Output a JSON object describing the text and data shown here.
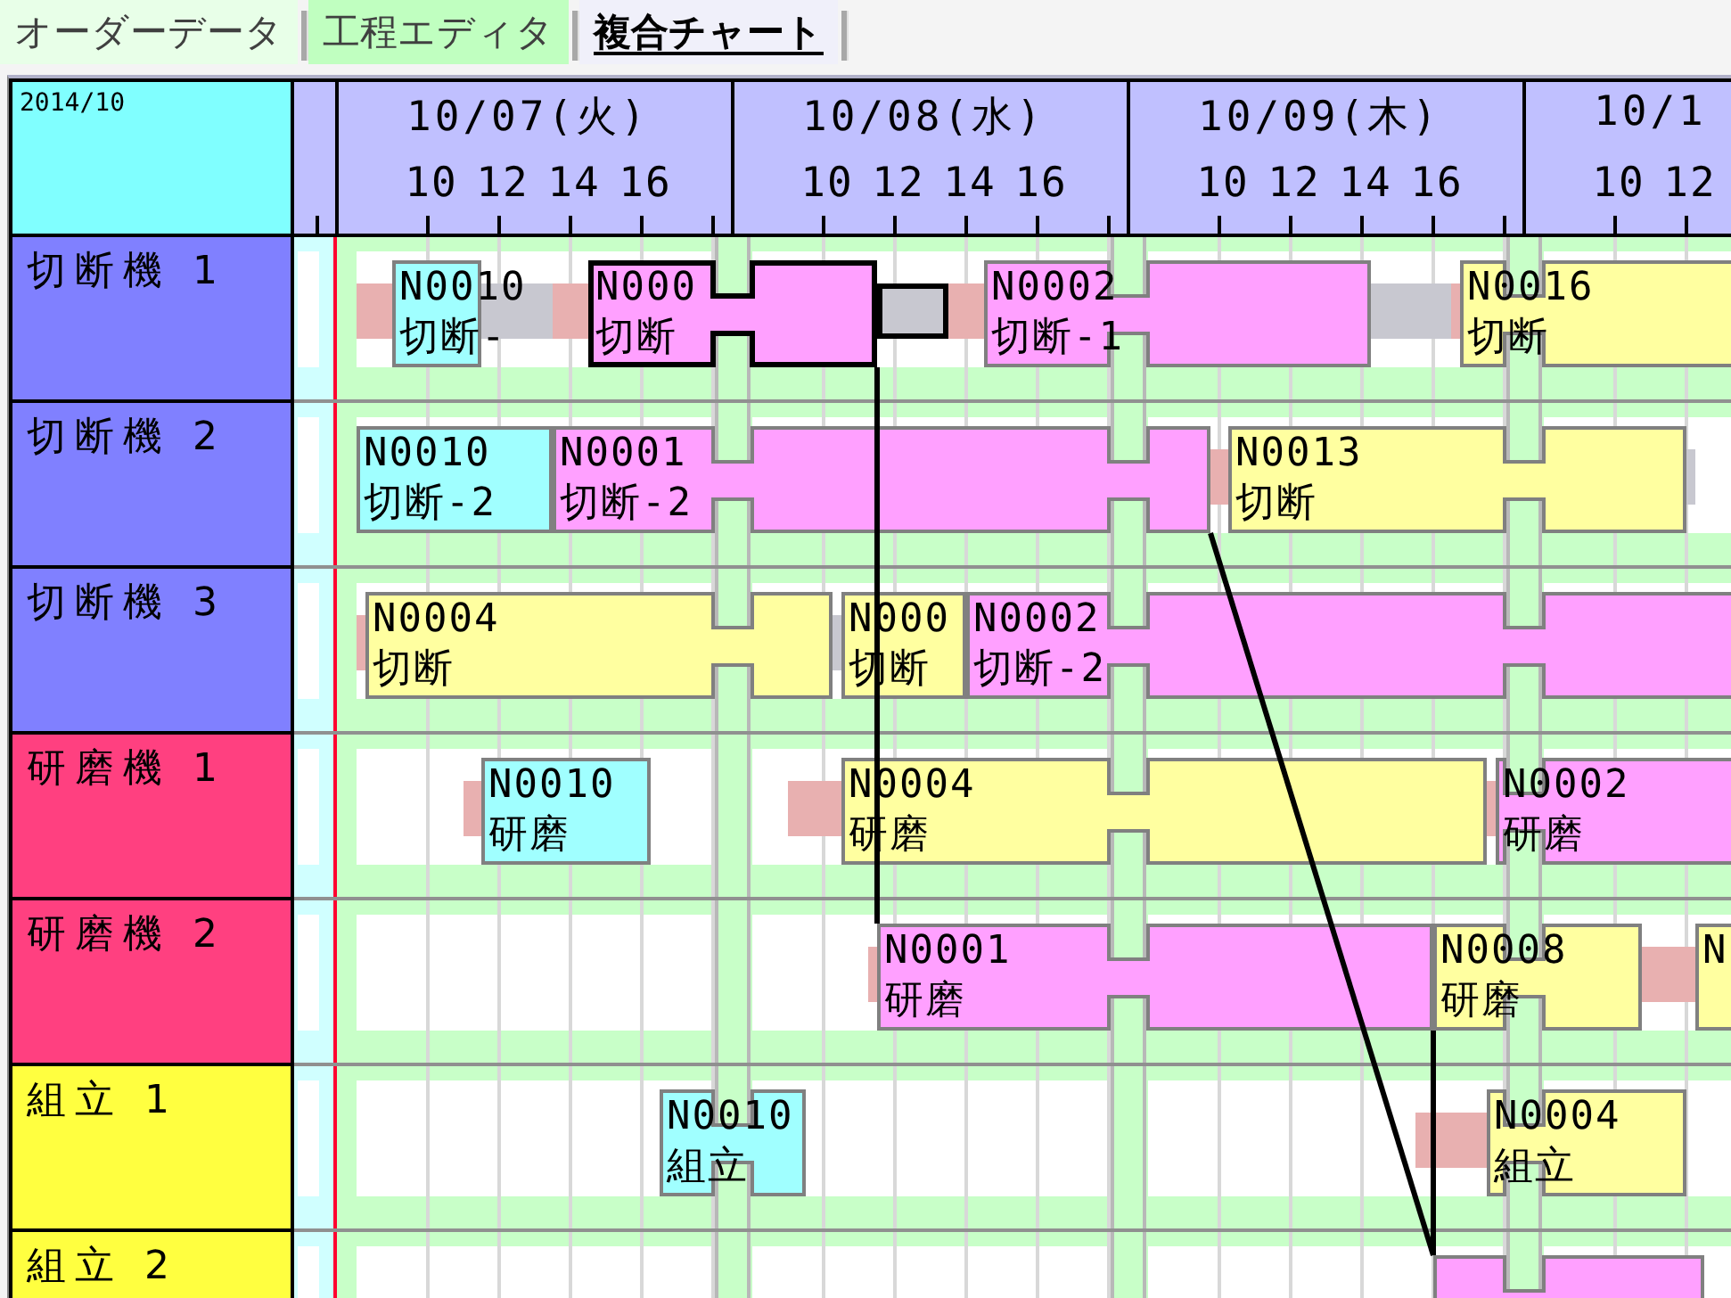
{
  "tabs": [
    {
      "label": "オーダーデータ",
      "selected": false,
      "color": "#e8ffe8"
    },
    {
      "label": "工程エディタ",
      "selected": false,
      "color": "#c0ffc0"
    },
    {
      "label": "複合チャート",
      "selected": true,
      "color": "#f0f0fa"
    }
  ],
  "chart": {
    "month": "2014/10",
    "days": [
      {
        "label": "10/07(火)",
        "hours": [
          "10",
          "12",
          "14",
          "16"
        ]
      },
      {
        "label": "10/08(水)",
        "hours": [
          "10",
          "12",
          "14",
          "16"
        ]
      },
      {
        "label": "10/09(木)",
        "hours": [
          "10",
          "12",
          "14",
          "16"
        ]
      },
      {
        "label": "10/1",
        "hours": [
          "10",
          "12"
        ]
      }
    ],
    "rows": [
      {
        "label": "切断機 1",
        "color": "#8080ff",
        "items": [
          {
            "kind": "setup",
            "selected": false
          },
          {
            "kind": "job",
            "order": "N0010",
            "process": "切断-",
            "color": "#a0ffff",
            "selected": false
          },
          {
            "kind": "wait",
            "selected": false
          },
          {
            "kind": "setup",
            "selected": false
          },
          {
            "kind": "job",
            "order": "N000",
            "process": "切断",
            "color": "#ffa0ff",
            "selected": true
          },
          {
            "kind": "wait",
            "selected": true
          },
          {
            "kind": "setup",
            "selected": false
          },
          {
            "kind": "job",
            "order": "N0002",
            "process": "切断-1",
            "color": "#ffa0ff",
            "selected": false
          },
          {
            "kind": "wait",
            "selected": false
          },
          {
            "kind": "setup",
            "selected": false
          },
          {
            "kind": "job",
            "order": "N0016",
            "process": "切断",
            "color": "#ffffa0",
            "selected": false
          }
        ]
      },
      {
        "label": "切断機 2",
        "color": "#8080ff",
        "items": [
          {
            "kind": "job",
            "order": "N0010",
            "process": "切断-2",
            "color": "#a0ffff",
            "selected": false
          },
          {
            "kind": "job",
            "order": "N0001",
            "process": "切断-2",
            "color": "#ffa0ff",
            "selected": false
          },
          {
            "kind": "setup",
            "selected": false
          },
          {
            "kind": "job",
            "order": "N0013",
            "process": "切断",
            "color": "#ffffa0",
            "selected": false
          },
          {
            "kind": "wait",
            "selected": false
          }
        ]
      },
      {
        "label": "切断機 3",
        "color": "#8080ff",
        "items": [
          {
            "kind": "setup",
            "selected": false
          },
          {
            "kind": "job",
            "order": "N0004",
            "process": "切断",
            "color": "#ffffa0",
            "selected": false
          },
          {
            "kind": "wait",
            "selected": false
          },
          {
            "kind": "job",
            "order": "N000",
            "process": "切断",
            "color": "#ffffa0",
            "selected": false
          },
          {
            "kind": "job",
            "order": "N0002",
            "process": "切断-2",
            "color": "#ffa0ff",
            "selected": false
          }
        ]
      },
      {
        "label": "研磨機 1",
        "color": "#ff4080",
        "items": [
          {
            "kind": "setup",
            "selected": false
          },
          {
            "kind": "job",
            "order": "N0010",
            "process": "研磨",
            "color": "#a0ffff",
            "selected": false
          },
          {
            "kind": "setup",
            "selected": false
          },
          {
            "kind": "job",
            "order": "N0004",
            "process": "研磨",
            "color": "#ffffa0",
            "selected": false
          },
          {
            "kind": "setup",
            "selected": false
          },
          {
            "kind": "job",
            "order": "N0002",
            "process": "研磨",
            "color": "#ffa0ff",
            "selected": false
          }
        ]
      },
      {
        "label": "研磨機 2",
        "color": "#ff4080",
        "items": [
          {
            "kind": "setup",
            "selected": false
          },
          {
            "kind": "job",
            "order": "N0001",
            "process": "研磨",
            "color": "#ffa0ff",
            "selected": false
          },
          {
            "kind": "job",
            "order": "N0008",
            "process": "研磨",
            "color": "#ffffa0",
            "selected": false
          },
          {
            "kind": "setup",
            "selected": false
          },
          {
            "kind": "job",
            "order": "N",
            "color": "#ffffa0",
            "selected": false
          }
        ]
      },
      {
        "label": "組立 1",
        "color": "#ffff40",
        "items": [
          {
            "kind": "job",
            "order": "N0010",
            "process": "組立",
            "color": "#a0ffff",
            "selected": false
          },
          {
            "kind": "setup",
            "selected": false
          },
          {
            "kind": "job",
            "order": "N0004",
            "process": "組立",
            "color": "#ffffa0",
            "selected": false
          }
        ]
      },
      {
        "label": "組立 2",
        "color": "#ffff40",
        "items": [
          {
            "kind": "job",
            "color": "#ffa0ff",
            "selected": false
          }
        ]
      }
    ]
  }
}
